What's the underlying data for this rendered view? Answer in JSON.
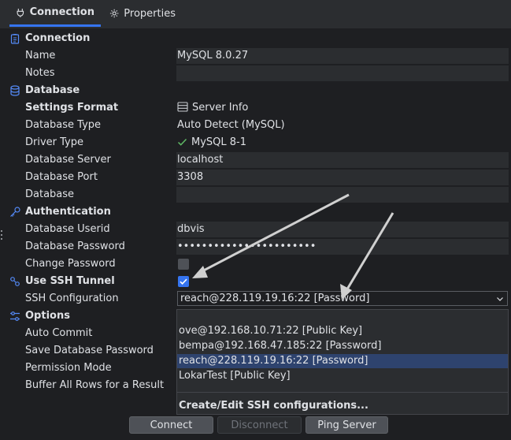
{
  "tabs": [
    {
      "label": "Connection",
      "icon": "plug-icon"
    },
    {
      "label": "Properties",
      "icon": "gear-icon"
    }
  ],
  "sections": {
    "connection": "Connection",
    "database": "Database",
    "authentication": "Authentication",
    "ssh": "Use SSH Tunnel",
    "options": "Options"
  },
  "fields": {
    "name": {
      "label": "Name",
      "value": "MySQL 8.0.27"
    },
    "notes": {
      "label": "Notes",
      "value": ""
    },
    "settings_format": {
      "label": "Settings Format",
      "value": "Server Info"
    },
    "database_type": {
      "label": "Database Type",
      "value": "Auto Detect (MySQL)"
    },
    "driver_type": {
      "label": "Driver Type",
      "value": "MySQL 8-1"
    },
    "database_server": {
      "label": "Database Server",
      "value": "localhost"
    },
    "database_port": {
      "label": "Database Port",
      "value": "3308"
    },
    "database": {
      "label": "Database",
      "value": ""
    },
    "userid": {
      "label": "Database Userid",
      "value": "dbvis"
    },
    "password": {
      "label": "Database Password",
      "value": "•••••••••••••••••••••••"
    },
    "change_password": {
      "label": "Change Password",
      "checked": false
    },
    "ssh_configuration": {
      "label": "SSH Configuration",
      "value": "reach@228.119.19.16:22 [Password]"
    },
    "auto_commit": {
      "label": "Auto Commit"
    },
    "save_password": {
      "label": "Save Database Password"
    },
    "permission_mode": {
      "label": "Permission Mode"
    },
    "buffer_rows": {
      "label": "Buffer All Rows for a Result"
    }
  },
  "use_ssh_checked": true,
  "ssh_options": [
    {
      "label": "ove@192.168.10.71:22 [Public Key]",
      "selected": false
    },
    {
      "label": "bempa@192.168.47.185:22 [Password]",
      "selected": false
    },
    {
      "label": "reach@228.119.19.16:22 [Password]",
      "selected": true
    },
    {
      "label": "LokarTest [Public Key]",
      "selected": false
    }
  ],
  "ssh_edit_label": "Create/Edit SSH configurations...",
  "buttons": {
    "connect": "Connect",
    "disconnect": "Disconnect",
    "ping": "Ping Server"
  },
  "colors": {
    "accent": "#3574f0",
    "selection": "#2e436e",
    "check_green": "#5fb865"
  }
}
